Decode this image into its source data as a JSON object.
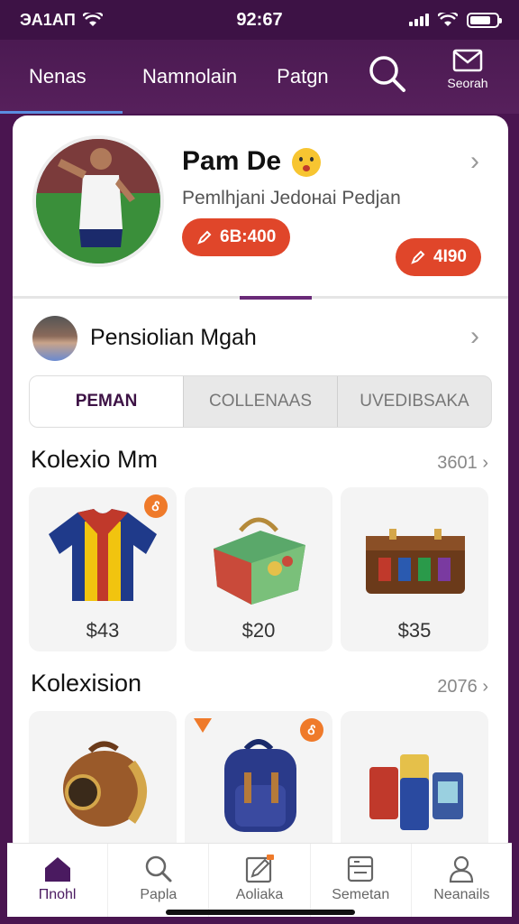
{
  "status": {
    "carrier": "ЭA1AП",
    "time": "92:67",
    "icons": [
      "wifi-icon",
      "signal-icon",
      "battery-icon"
    ]
  },
  "top_nav": {
    "tabs": [
      {
        "label": "Nenas",
        "active": true
      },
      {
        "label": "Namnolain",
        "active": false
      },
      {
        "label": "Patgn",
        "active": false
      }
    ],
    "search_icon": "search-icon",
    "mail_label": "Seorah"
  },
  "profile": {
    "name": "Pam De",
    "subtitle": "Pemlhjani Jedoнai Pedjan",
    "pill_left": "6В:400",
    "pill_right": "4Ӏ90"
  },
  "sub_profile": {
    "title": "Pensiolian Mgah"
  },
  "segments": [
    {
      "label": "PEMAN",
      "active": true
    },
    {
      "label": "COLLENAAS",
      "active": false
    },
    {
      "label": "UVEDIBSAKA",
      "active": false
    }
  ],
  "section1": {
    "title": "Kolexio Mm",
    "count": "3601",
    "items": [
      {
        "price": "$43",
        "icon": "jersey-icon",
        "badge": "Ꮄ"
      },
      {
        "price": "$20",
        "icon": "lunchbox-icon"
      },
      {
        "price": "$35",
        "icon": "suitcase-icon"
      }
    ]
  },
  "section2": {
    "title": "Kolexision",
    "count": "2076",
    "items": [
      {
        "icon": "bronze-helmet-icon"
      },
      {
        "icon": "backpack-icon",
        "badge": "Ꮄ"
      },
      {
        "icon": "cans-icon"
      }
    ]
  },
  "bottom_nav": [
    {
      "label": "Пnohl",
      "icon": "home-icon",
      "active": true
    },
    {
      "label": "Papla",
      "icon": "search-icon",
      "active": false
    },
    {
      "label": "Aoliaka",
      "icon": "edit-icon",
      "active": false
    },
    {
      "label": "Semetan",
      "icon": "list-icon",
      "active": false
    },
    {
      "label": "Neanails",
      "icon": "profile-icon",
      "active": false
    }
  ],
  "colors": {
    "brand": "#4a1550",
    "accent_orange": "#e0462a",
    "tab_underline": "#5b8de0"
  }
}
